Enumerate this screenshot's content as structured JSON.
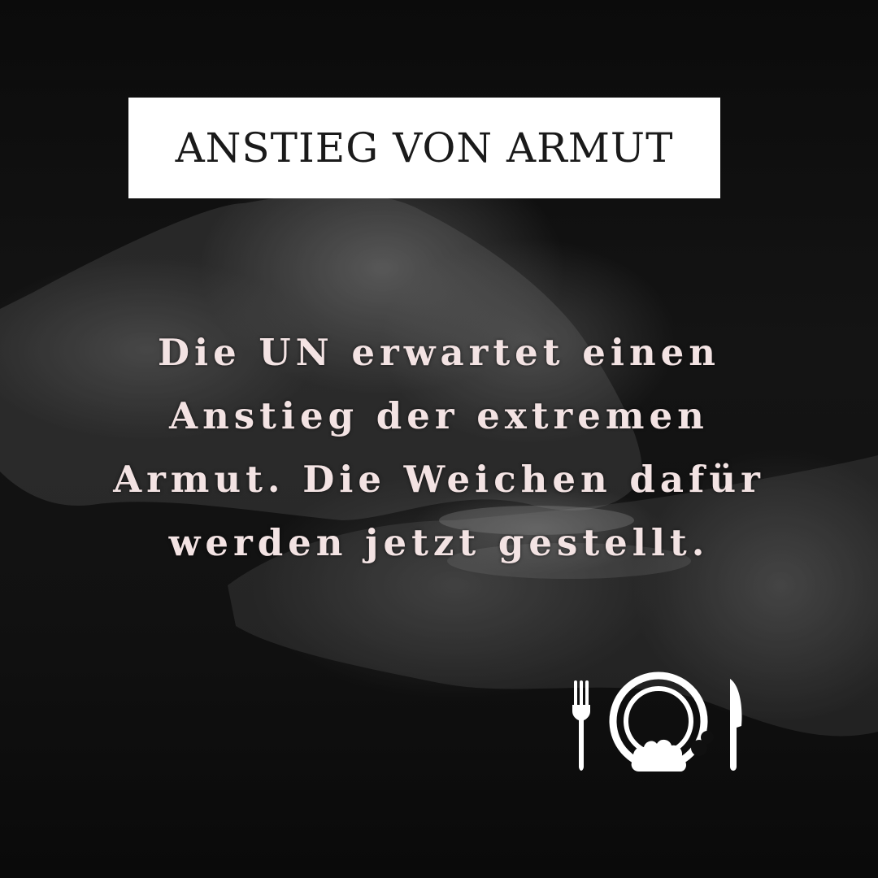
{
  "headline": {
    "text": "ANSTIEG VON ARMUT"
  },
  "body": {
    "lines": [
      "Die UN erwartet einen",
      "Anstieg der extremen",
      "Armut. Die Weichen dafür",
      "werden jetzt gestellt."
    ]
  },
  "icons": {
    "logo": "plate-fork-knife-icon"
  },
  "colors": {
    "background": "#101010",
    "headline_box": "#ffffff",
    "headline_text": "#1a1a1a",
    "body_text": "#f3e3e3",
    "icon": "#ffffff"
  }
}
